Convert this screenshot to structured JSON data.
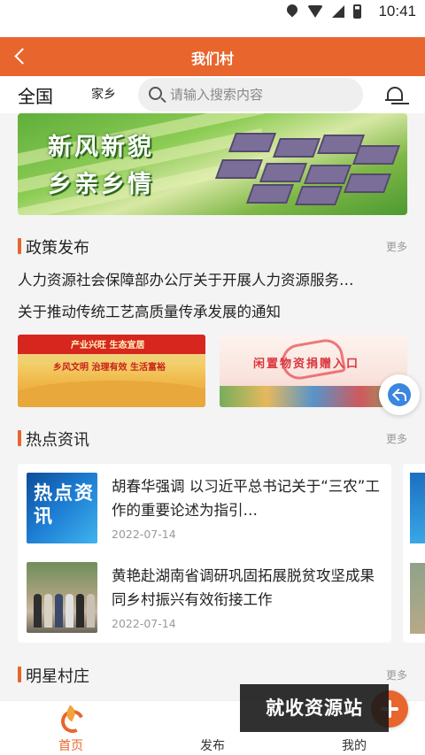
{
  "status_bar": {
    "time": "10:41"
  },
  "header": {
    "title": "我们村"
  },
  "search_row": {
    "country": "全国",
    "hometown": "家乡",
    "search_placeholder": "请输入搜索内容"
  },
  "banner": {
    "slogan_line1": "新风新貌",
    "slogan_line2": "乡亲乡情"
  },
  "policy": {
    "title": "政策发布",
    "more": "更多",
    "items": [
      "人力资源社会保障部办公厅关于开展人力资源服务…",
      "关于推动传统工艺高质量传承发展的通知"
    ],
    "image1_text1": "产业兴旺 生态宜居",
    "image1_text2": "乡风文明 治理有效 生活富裕",
    "image2_text": "闲置物资捐赠入口"
  },
  "news": {
    "title": "热点资讯",
    "more": "更多",
    "thumb1_text": "热点资讯",
    "items": [
      {
        "title": "胡春华强调 以习近平总书记关于“三农”工作的重要论述为指引…",
        "date": "2022-07-14"
      },
      {
        "title": "黄艳赴湖南省调研巩固拓展脱贫攻坚成果同乡村振兴有效衔接工作",
        "date": "2022-07-14"
      }
    ]
  },
  "villages": {
    "title": "明星村庄",
    "more": "更多"
  },
  "bottom_nav": {
    "home": "首页",
    "publish": "发布",
    "mine": "我的"
  },
  "watermark": "就收资源站",
  "colors": {
    "accent": "#e8652d",
    "background": "#f4f4f4"
  }
}
